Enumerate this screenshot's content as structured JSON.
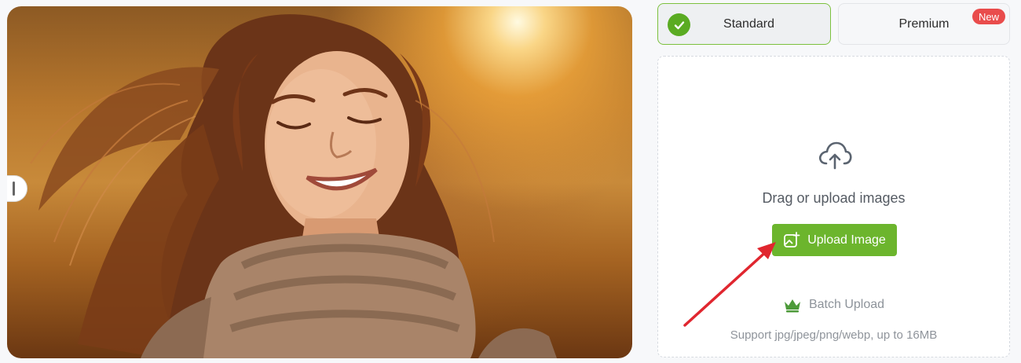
{
  "tabs": {
    "standard_label": "Standard",
    "premium_label": "Premium",
    "premium_badge": "New"
  },
  "upload": {
    "prompt": "Drag or upload images",
    "button_label": "Upload Image",
    "batch_label": "Batch Upload",
    "support_text": "Support jpg/jpeg/png/webp, up to 16MB"
  },
  "colors": {
    "accent_green": "#6cb52d",
    "badge_red": "#e94c4c",
    "annotation_arrow": "#e0262f"
  },
  "icons": [
    "check-icon",
    "cloud-upload-icon",
    "image-add-icon",
    "crown-icon",
    "compare-handle-icon"
  ]
}
